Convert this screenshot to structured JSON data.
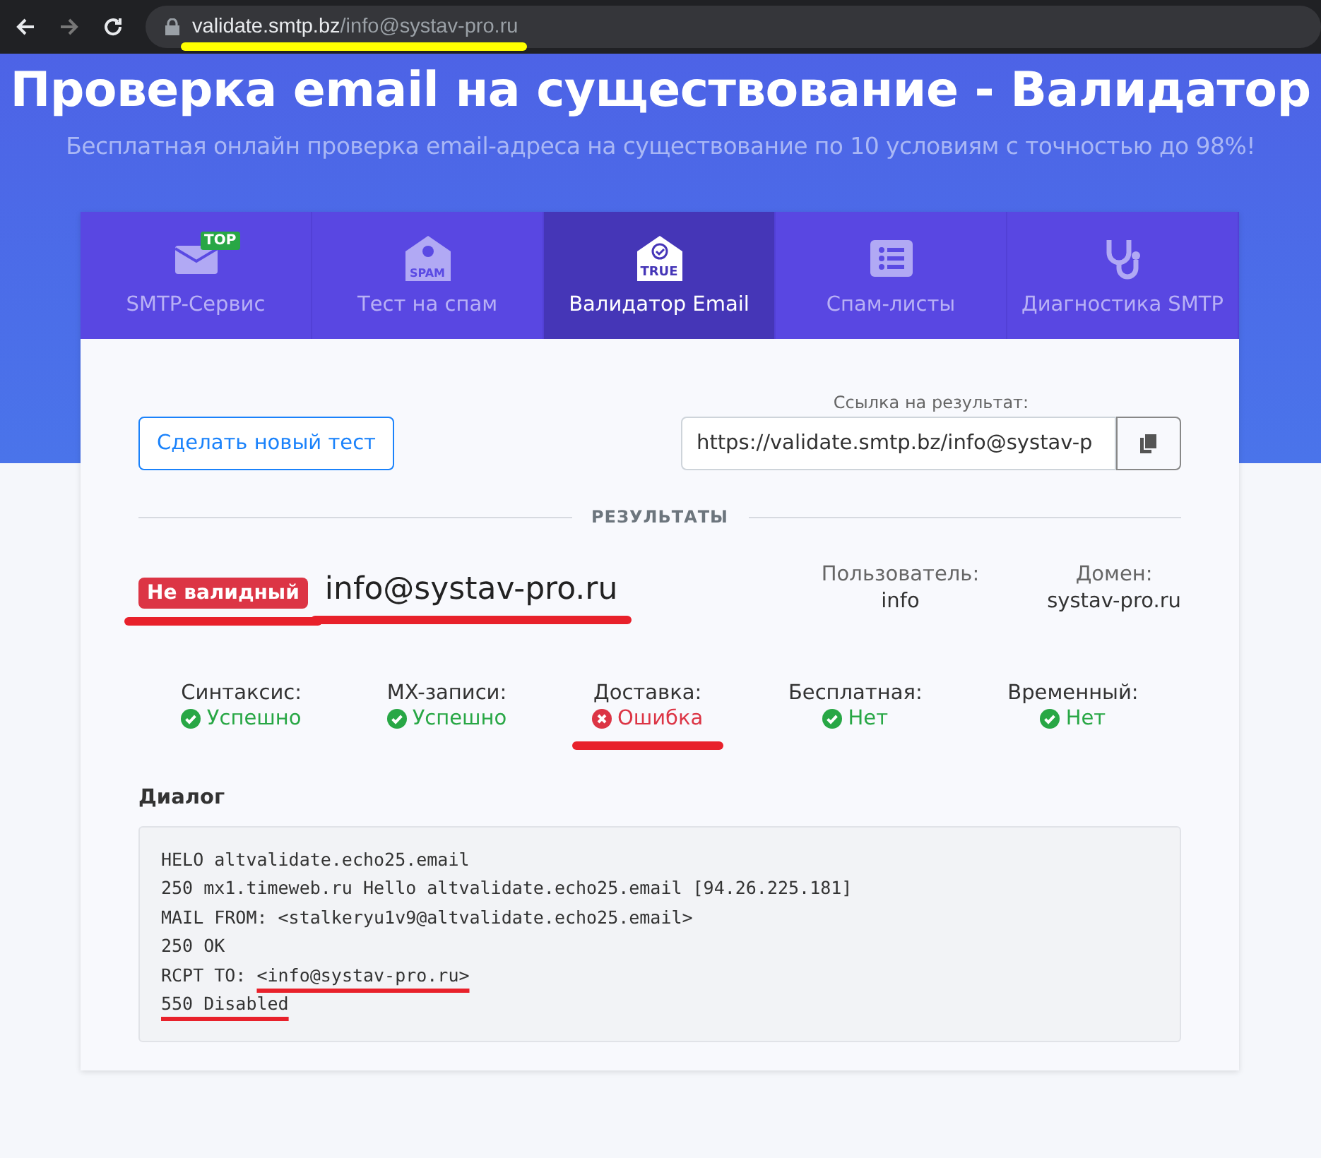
{
  "browser": {
    "url_host": "validate.smtp.bz",
    "url_path": "/info@systav-pro.ru",
    "url_highlighted": true
  },
  "hero": {
    "title": "Проверка email на существование - Валидатор",
    "subtitle": "Бесплатная онлайн проверка email-адреса на существование по 10 условиям с точностью до 98%!"
  },
  "tabs": [
    {
      "kind": "envelope",
      "label": "SMTP-Сервис",
      "badge": "TOP",
      "selected": false
    },
    {
      "kind": "spam",
      "label": "Тест на спам",
      "icon_text": "SPAM",
      "selected": false
    },
    {
      "kind": "true",
      "label": "Валидатор Email",
      "icon_text": "TRUE",
      "selected": true
    },
    {
      "kind": "list",
      "label": "Спам-листы",
      "selected": false
    },
    {
      "kind": "stethoscope",
      "label": "Диагностика SMTP",
      "selected": false
    }
  ],
  "new_test_button": "Сделать новый тест",
  "result_link": {
    "label": "Ссылка на результат:",
    "value": "https://validate.smtp.bz/info@systav-p"
  },
  "results_heading": "РЕЗУЛЬТАТЫ",
  "verdict": {
    "badge": "Не валидный",
    "email": "info@systav-pro.ru",
    "underlined": true
  },
  "details": [
    {
      "label": "Пользователь:",
      "value": "info"
    },
    {
      "label": "Домен:",
      "value": "systav-pro.ru"
    }
  ],
  "checks": [
    {
      "label": "Синтаксис:",
      "kind": "ok",
      "value": "Успешно",
      "underlined": false
    },
    {
      "label": "MX-записи:",
      "kind": "ok",
      "value": "Успешно",
      "underlined": false
    },
    {
      "label": "Доставка:",
      "kind": "error",
      "value": "Ошибка",
      "underlined": true
    },
    {
      "label": "Бесплатная:",
      "kind": "ok",
      "value": "Нет",
      "underlined": false
    },
    {
      "label": "Временный:",
      "kind": "ok",
      "value": "Нет",
      "underlined": false
    }
  ],
  "dialog": {
    "title": "Диалог",
    "lines": [
      [
        {
          "text": "HELO altvalidate.echo25.email",
          "underlined": false
        }
      ],
      [
        {
          "text": "250 mx1.timeweb.ru Hello altvalidate.echo25.email [94.26.225.181]",
          "underlined": false
        }
      ],
      [
        {
          "text": "MAIL FROM: <stalkeryu1v9@altvalidate.echo25.email>",
          "underlined": false
        }
      ],
      [
        {
          "text": "250 OK",
          "underlined": false
        }
      ],
      [
        {
          "text": "RCPT TO: ",
          "underlined": false
        },
        {
          "text": "<info@systav-pro.ru>",
          "underlined": true
        }
      ],
      [
        {
          "text": "550 Disabled",
          "underlined": true
        }
      ]
    ]
  }
}
